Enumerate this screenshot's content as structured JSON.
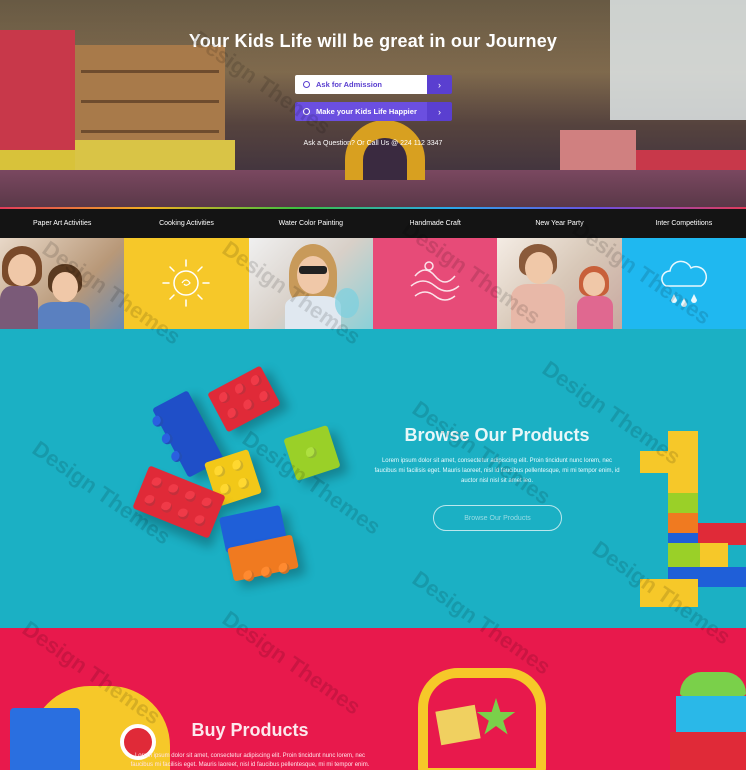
{
  "hero": {
    "title": "Your Kids Life will be great in our Journey",
    "buttons": [
      {
        "label": "Ask for Admission",
        "icon": "user-icon"
      },
      {
        "label": "Make your Kids Life Happier",
        "icon": "smile-icon"
      }
    ],
    "contact_note": "Ask a Question? Or Call Us @ 224 112 3347"
  },
  "activities": {
    "tabs": [
      "Paper Art Activities",
      "Cooking Activities",
      "Water Color Painting",
      "Handmade Craft",
      "New Year Party",
      "Inter Competitions"
    ],
    "tile_colors": {
      "yellow": "#f6c829",
      "pink": "#e74b78",
      "blue": "#1fb8f0"
    }
  },
  "browse": {
    "title": "Browse Our Products",
    "text": "Lorem ipsum dolor sit amet, consectetur adipiscing elit. Proin tincidunt nunc lorem, nec faucibus mi facilisis eget. Mauris laoreet, nisl id faucibus pellentesque, mi mi tempor enim, id auctor nisl nisl sit amet leo.",
    "button_label": "Browse Our Products",
    "background": "#1bb0c4"
  },
  "buy": {
    "title": "Buy Products",
    "text": "Lorem ipsum dolor sit amet, consectetur adipiscing elit. Proin tincidunt nunc lorem, nec faucibus mi facilisis eget. Mauris laoreet, nisl id faucibus pellentesque, mi mi tempor enim.",
    "background": "#e8194c"
  },
  "watermark": "Design Themes",
  "accent": "#6b4fe0"
}
